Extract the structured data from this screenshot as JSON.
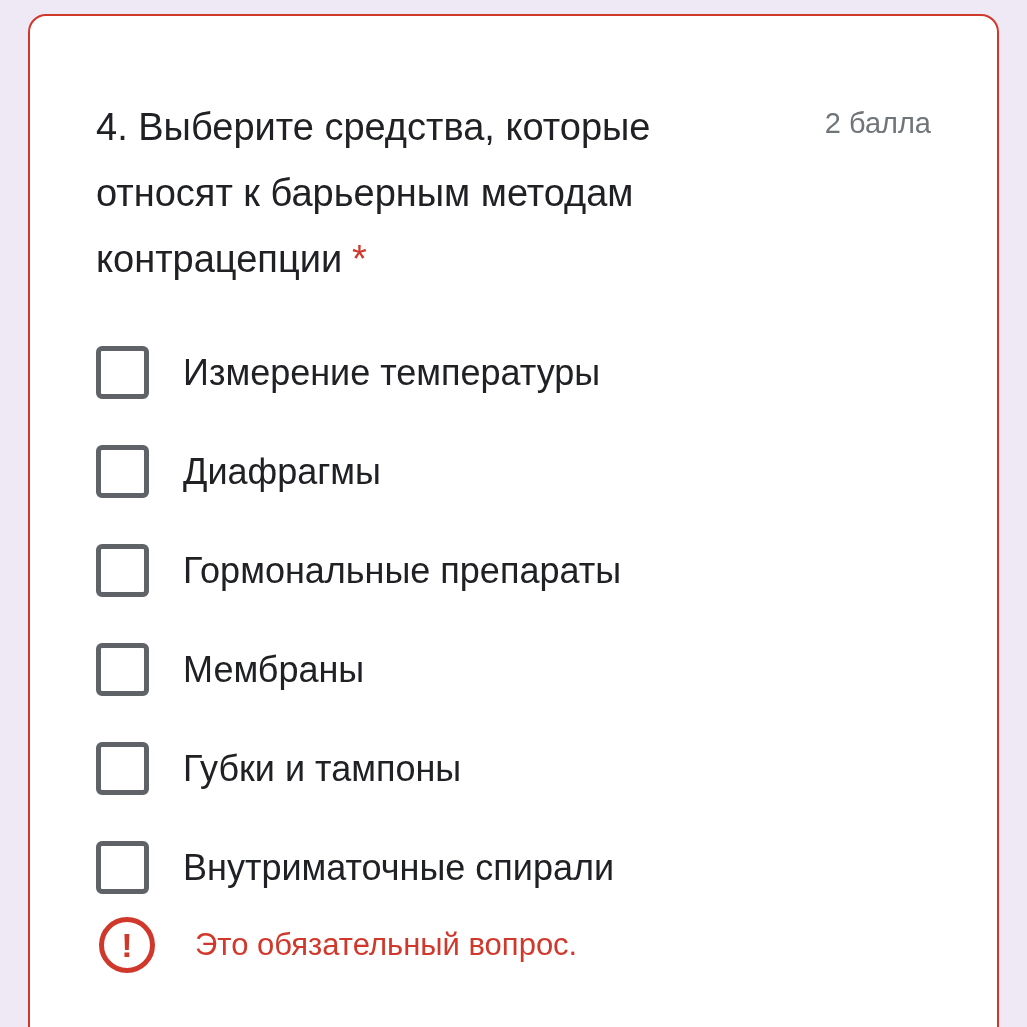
{
  "question": {
    "title": "4. Выберите средства, которые относят к барьерным методам контрацепции",
    "required_mark": "*",
    "points": "2 балла"
  },
  "options": [
    {
      "label": "Измерение температуры",
      "checked": false
    },
    {
      "label": "Диафрагмы",
      "checked": false
    },
    {
      "label": "Гормональные препараты",
      "checked": false
    },
    {
      "label": "Мембраны",
      "checked": false
    },
    {
      "label": "Губки и тампоны",
      "checked": false
    },
    {
      "label": "Внутриматочные спирали",
      "checked": false
    }
  ],
  "error": {
    "icon": "!",
    "message": "Это обязательный вопрос."
  }
}
